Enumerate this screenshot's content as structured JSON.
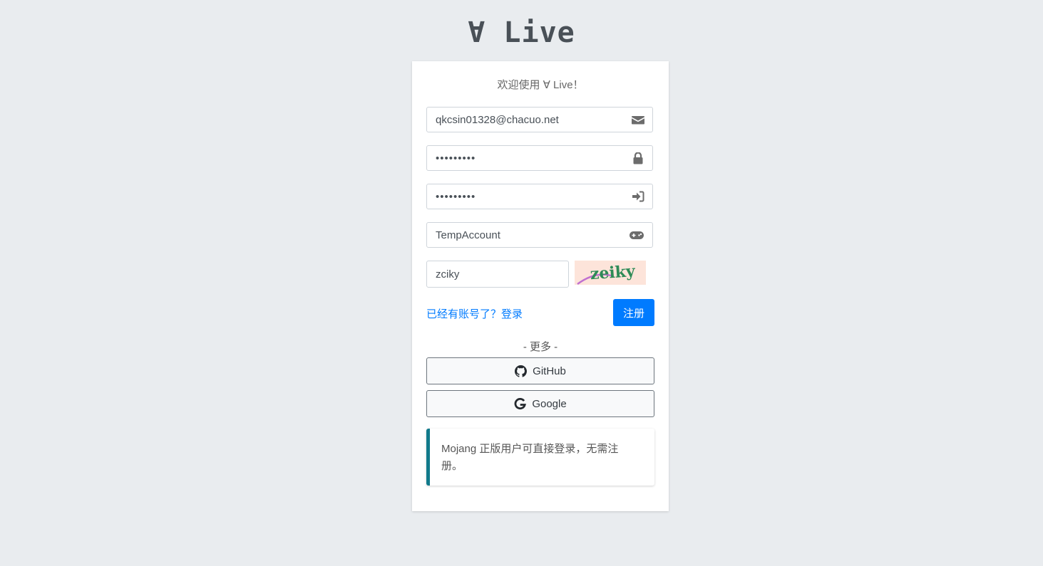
{
  "brand": {
    "title": "∀ Live"
  },
  "form": {
    "welcome": "欢迎使用 ∀ Live！",
    "email": {
      "value": "qkcsin01328@chacuo.net",
      "icon": "envelope-icon"
    },
    "password": {
      "value": "•••••••••",
      "icon": "lock-icon"
    },
    "confirm_password": {
      "value": "•••••••••",
      "icon": "sign-in-icon"
    },
    "nickname": {
      "value": "TempAccount",
      "icon": "gamepad-icon"
    },
    "captcha": {
      "value": "zciky",
      "image_text": "zeiky"
    },
    "login_link": "已经有账号了？登录",
    "register_button": "注册"
  },
  "more": {
    "label": "- 更多 -",
    "github_button": "GitHub",
    "google_button": "Google"
  },
  "callout": {
    "text": "Mojang 正版用户可直接登录，无需注册。",
    "accent_color": "#117a8b"
  },
  "colors": {
    "primary": "#007bff",
    "background": "#e9ecef"
  }
}
